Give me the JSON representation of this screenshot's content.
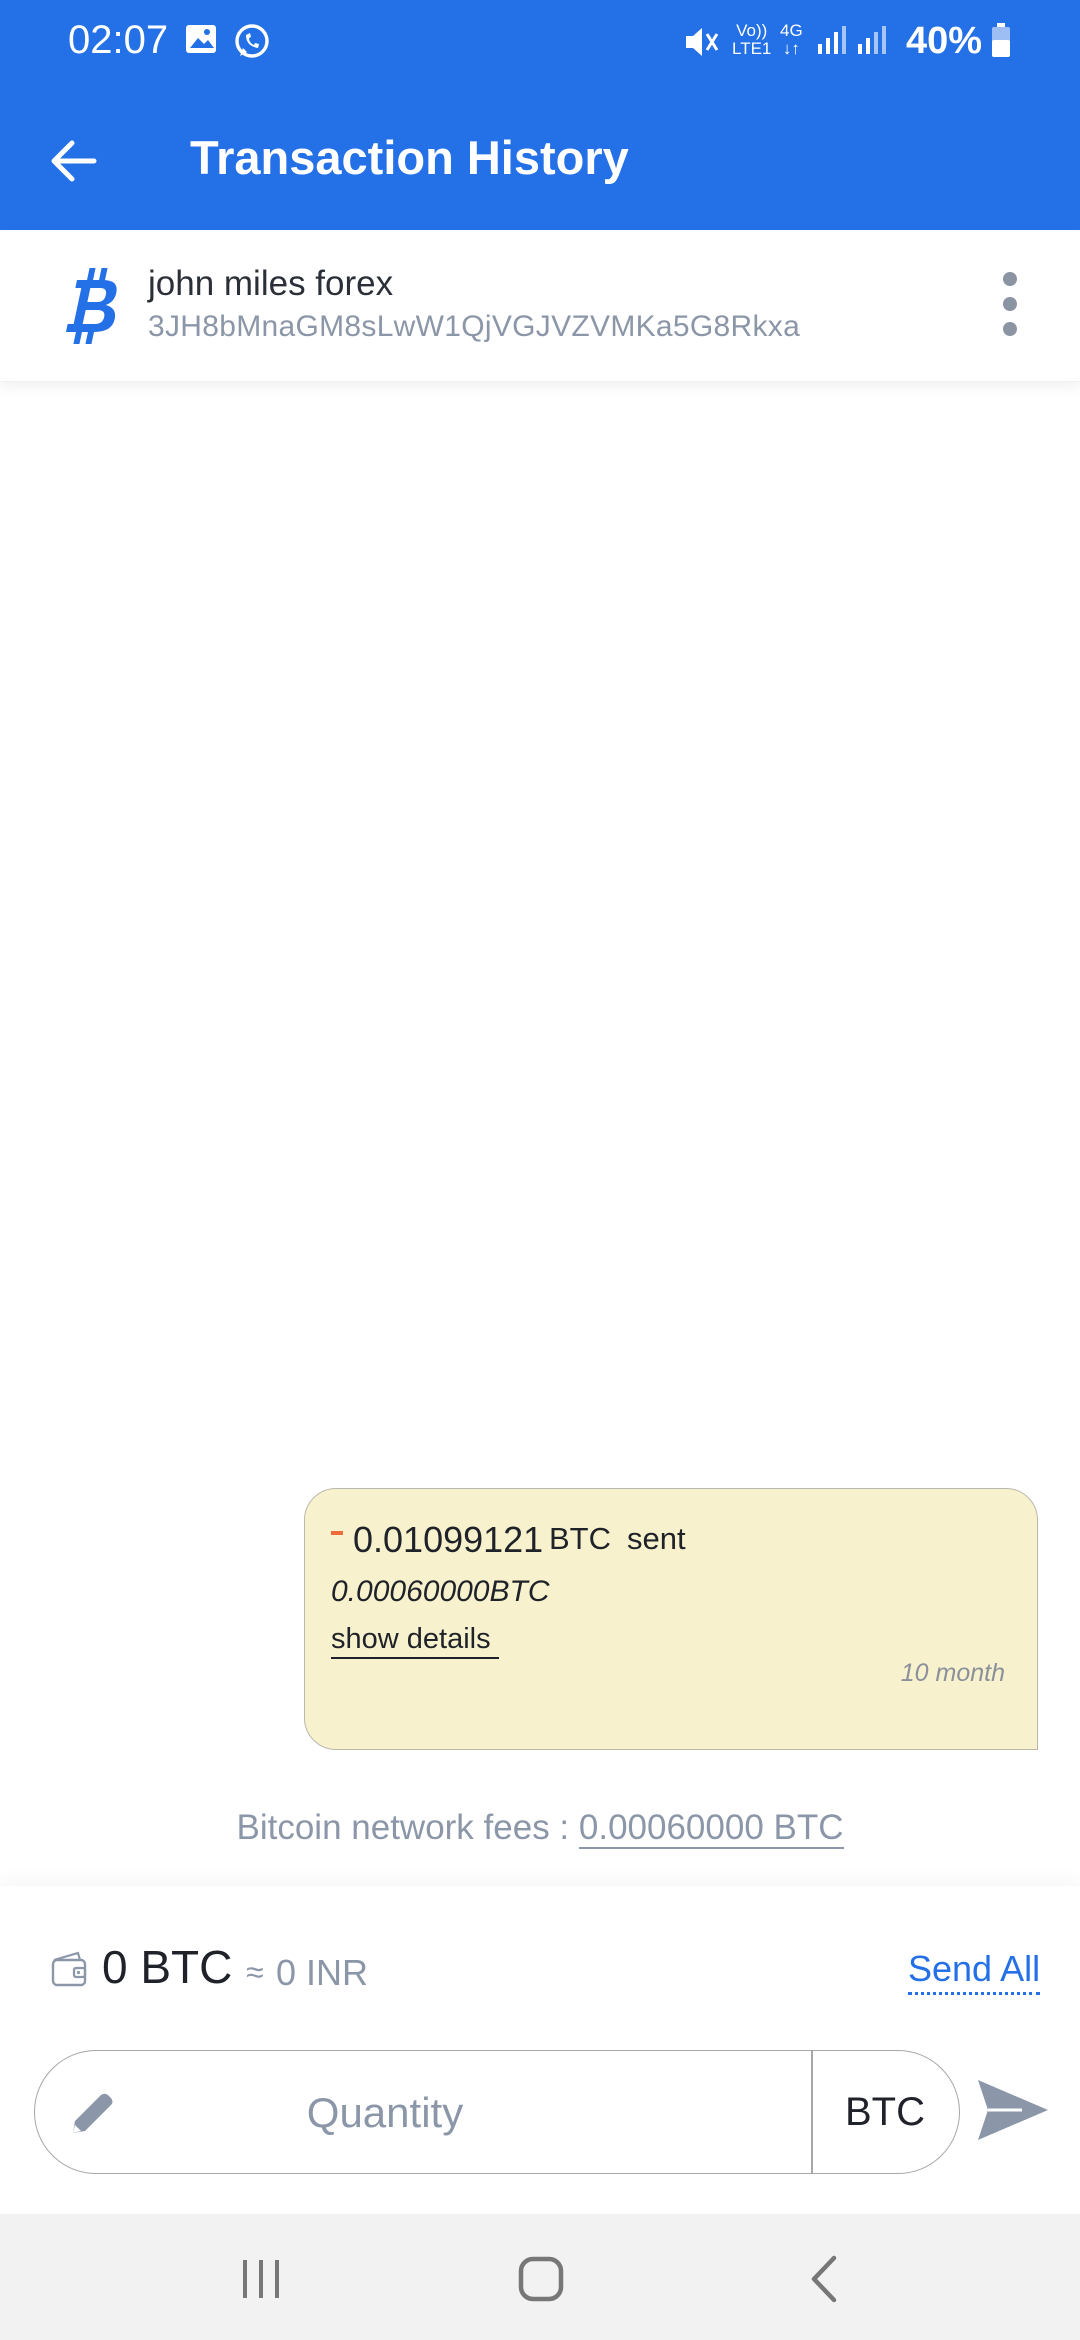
{
  "status_bar": {
    "time": "02:07",
    "network_top": "Vo))",
    "network_bottom": "LTE1",
    "network_type": "4G",
    "battery": "40%",
    "icons": [
      "gallery-icon",
      "whatsapp-icon",
      "mute-icon",
      "signal-icon",
      "battery-icon"
    ]
  },
  "app_bar": {
    "title": "Transaction History",
    "back_icon": "back-arrow-icon"
  },
  "wallet": {
    "name": "john miles forex",
    "address": "3JH8bMnaGM8sLwW1QjVGJVZVMKa5G8Rkxa",
    "icon": "bitcoin-icon",
    "menu_icon": "more-vertical-icon"
  },
  "transaction": {
    "sign": "-",
    "amount": "0.01099121",
    "unit": "BTC",
    "status": "sent",
    "fee": "0.00060000BTC",
    "details_link": "show details",
    "time": "10 month"
  },
  "network_fees": {
    "label": "Bitcoin network fees : ",
    "value": "0.00060000 BTC"
  },
  "balance": {
    "btc": "0 BTC",
    "approx": "≈",
    "inr": "0 INR",
    "send_all": "Send All"
  },
  "send_form": {
    "quantity_placeholder": "Quantity",
    "currency": "BTC"
  },
  "colors": {
    "primary": "#2470e6",
    "bubble": "#f7f2cd",
    "negative": "#f06b3b",
    "muted": "#8b97a8"
  }
}
